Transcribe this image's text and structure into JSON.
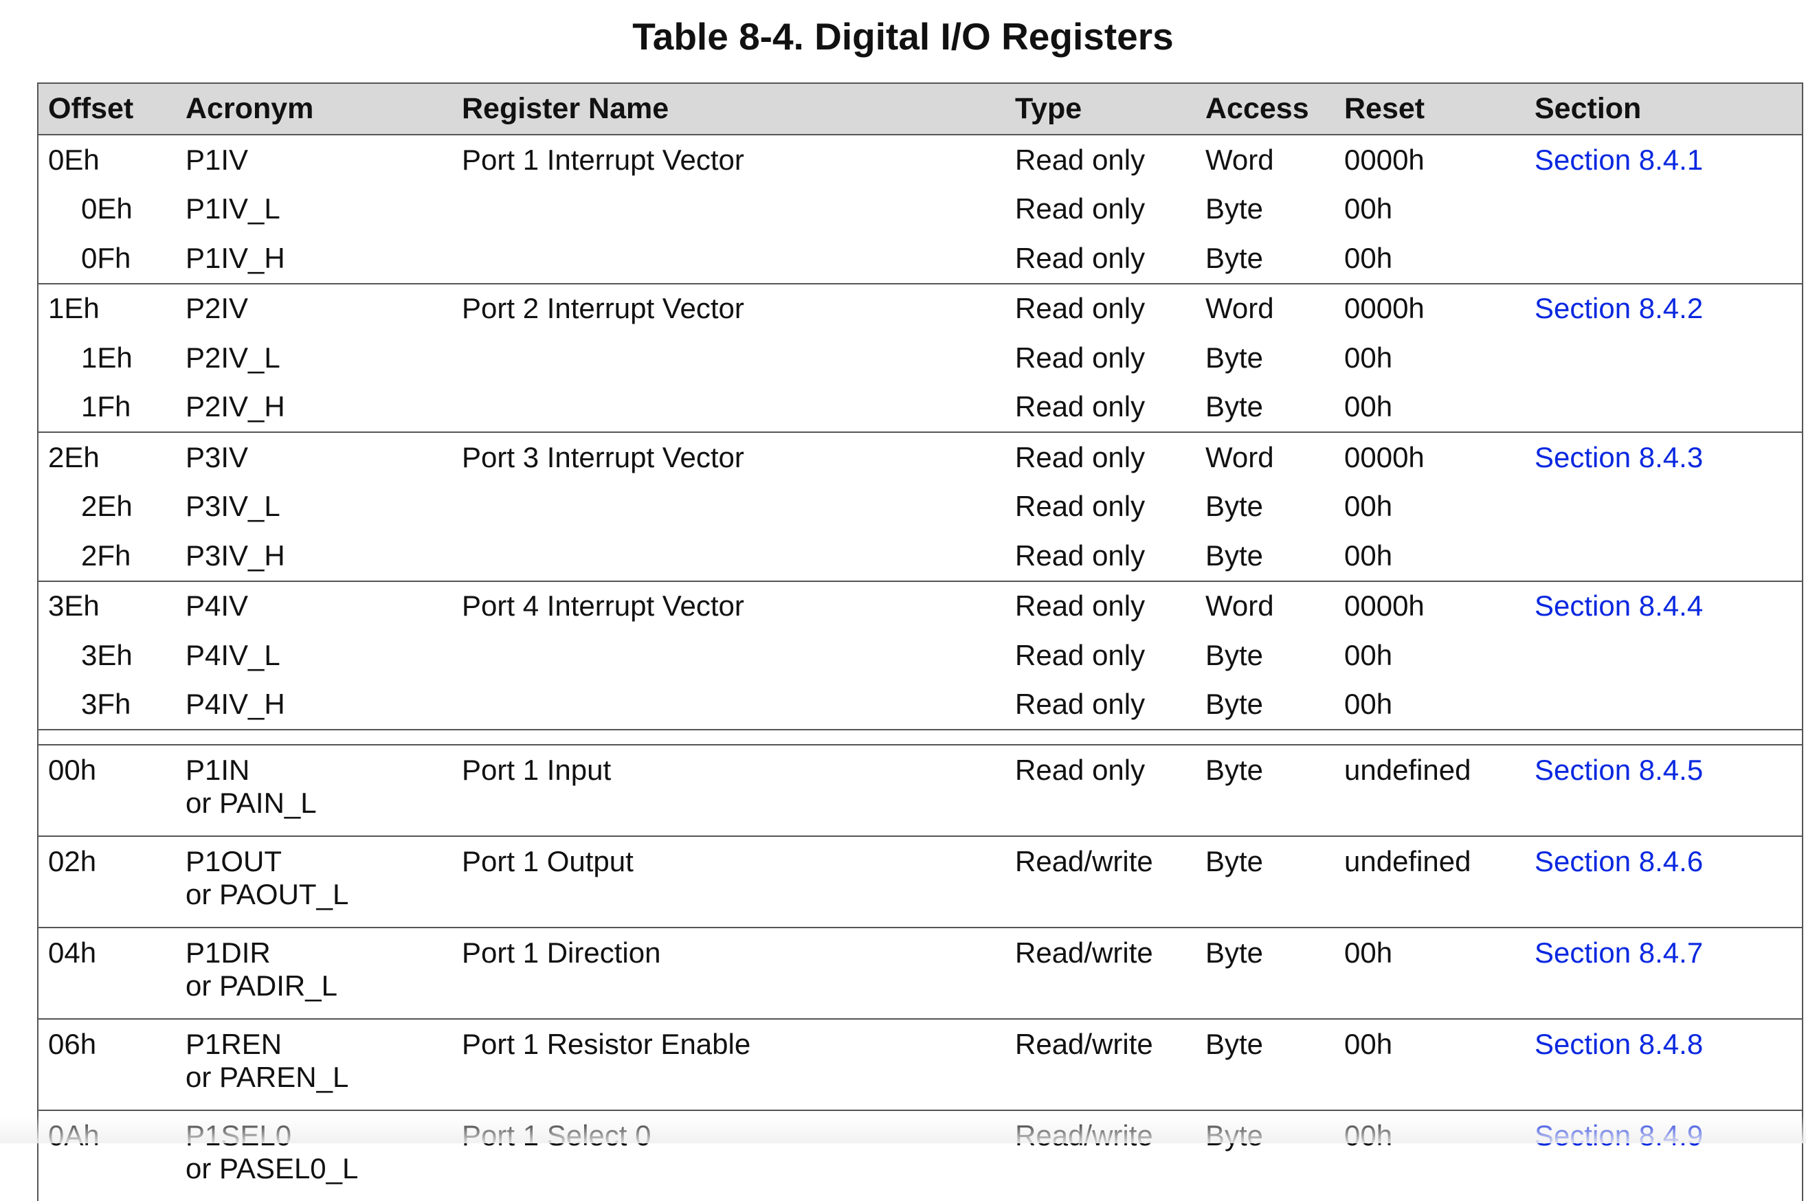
{
  "title": "Table 8-4. Digital I/O Registers",
  "columns": [
    "Offset",
    "Acronym",
    "Register Name",
    "Type",
    "Access",
    "Reset",
    "Section"
  ],
  "groups": [
    {
      "rows": [
        {
          "offset": "0Eh",
          "acronym": "P1IV",
          "name": "Port 1 Interrupt Vector",
          "type": "Read only",
          "access": "Word",
          "reset": "0000h",
          "section": "Section 8.4.1"
        },
        {
          "offset": "0Eh",
          "acronym": "P1IV_L",
          "name": "",
          "type": "Read only",
          "access": "Byte",
          "reset": "00h",
          "section": ""
        },
        {
          "offset": "0Fh",
          "acronym": "P1IV_H",
          "name": "",
          "type": "Read only",
          "access": "Byte",
          "reset": "00h",
          "section": ""
        }
      ]
    },
    {
      "rows": [
        {
          "offset": "1Eh",
          "acronym": "P2IV",
          "name": "Port 2 Interrupt Vector",
          "type": "Read only",
          "access": "Word",
          "reset": "0000h",
          "section": "Section 8.4.2"
        },
        {
          "offset": "1Eh",
          "acronym": "P2IV_L",
          "name": "",
          "type": "Read only",
          "access": "Byte",
          "reset": "00h",
          "section": ""
        },
        {
          "offset": "1Fh",
          "acronym": "P2IV_H",
          "name": "",
          "type": "Read only",
          "access": "Byte",
          "reset": "00h",
          "section": ""
        }
      ]
    },
    {
      "rows": [
        {
          "offset": "2Eh",
          "acronym": "P3IV",
          "name": "Port 3 Interrupt Vector",
          "type": "Read only",
          "access": "Word",
          "reset": "0000h",
          "section": "Section 8.4.3"
        },
        {
          "offset": "2Eh",
          "acronym": "P3IV_L",
          "name": "",
          "type": "Read only",
          "access": "Byte",
          "reset": "00h",
          "section": ""
        },
        {
          "offset": "2Fh",
          "acronym": "P3IV_H",
          "name": "",
          "type": "Read only",
          "access": "Byte",
          "reset": "00h",
          "section": ""
        }
      ]
    },
    {
      "rows": [
        {
          "offset": "3Eh",
          "acronym": "P4IV",
          "name": "Port 4 Interrupt Vector",
          "type": "Read only",
          "access": "Word",
          "reset": "0000h",
          "section": "Section 8.4.4"
        },
        {
          "offset": "3Eh",
          "acronym": "P4IV_L",
          "name": "",
          "type": "Read only",
          "access": "Byte",
          "reset": "00h",
          "section": ""
        },
        {
          "offset": "3Fh",
          "acronym": "P4IV_H",
          "name": "",
          "type": "Read only",
          "access": "Byte",
          "reset": "00h",
          "section": ""
        }
      ]
    }
  ],
  "port_rows": [
    {
      "offset": "00h",
      "acronym": "P1IN",
      "acronym_alt": "or PAIN_L",
      "name": "Port 1 Input",
      "type": "Read only",
      "access": "Byte",
      "reset": "undefined",
      "section": "Section 8.4.5"
    },
    {
      "offset": "02h",
      "acronym": "P1OUT",
      "acronym_alt": "or PAOUT_L",
      "name": "Port 1 Output",
      "type": "Read/write",
      "access": "Byte",
      "reset": "undefined",
      "section": "Section 8.4.6"
    },
    {
      "offset": "04h",
      "acronym": "P1DIR",
      "acronym_alt": "or PADIR_L",
      "name": "Port 1 Direction",
      "type": "Read/write",
      "access": "Byte",
      "reset": "00h",
      "section": "Section 8.4.7"
    },
    {
      "offset": "06h",
      "acronym": "P1REN",
      "acronym_alt": "or PAREN_L",
      "name": "Port 1 Resistor Enable",
      "type": "Read/write",
      "access": "Byte",
      "reset": "00h",
      "section": "Section 8.4.8"
    },
    {
      "offset": "0Ah",
      "acronym": "P1SEL0",
      "acronym_alt": "or PASEL0_L",
      "name": "Port 1 Select 0",
      "type": "Read/write",
      "access": "Byte",
      "reset": "00h",
      "section": "Section 8.4.9"
    }
  ],
  "colors": {
    "link": "#0a28e0",
    "header_bg": "#d9d9d9",
    "rule": "#555555"
  }
}
